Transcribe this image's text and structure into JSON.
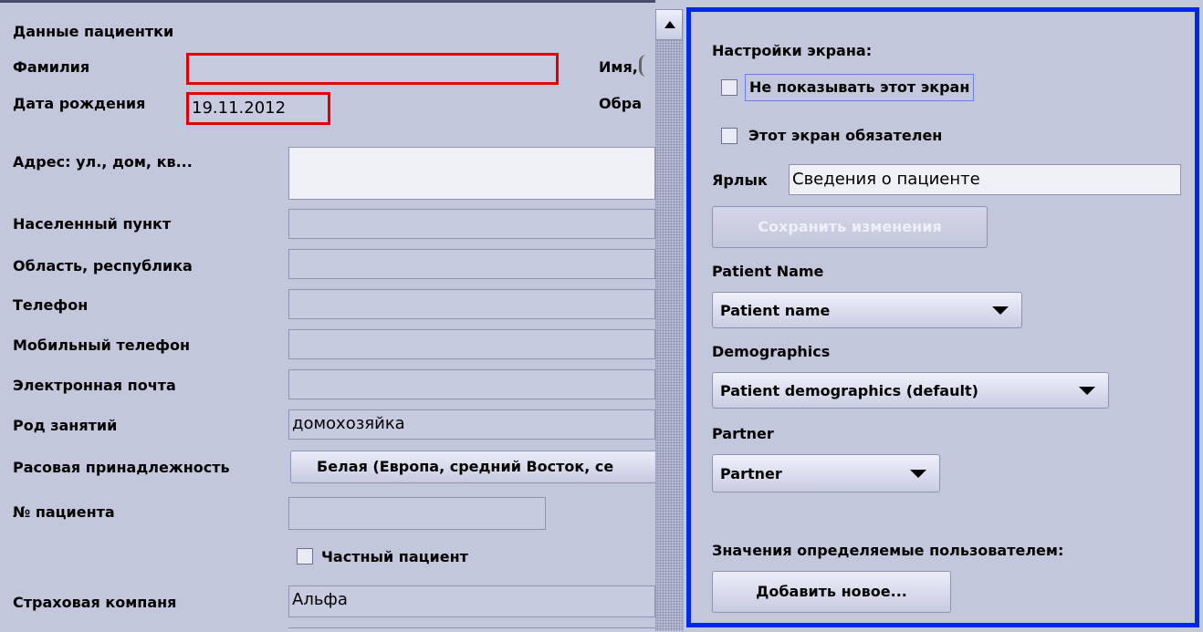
{
  "patient": {
    "section_title": "Данные пациентки",
    "surname_label": "Фамилия",
    "surname_value": "",
    "name_label": "Имя,",
    "dob_label": "Дата рождения",
    "dob_value": "19.11.2012",
    "education_label": "Обра",
    "address_label": "Адрес: ул., дом, кв...",
    "city_label": "Населенный пункт",
    "region_label": "Область, республика",
    "phone_label": "Телефон",
    "mobile_label": "Мобильный телефон",
    "email_label": "Электронная почта",
    "occupation_label": "Род занятий",
    "occupation_value": "домохозяйка",
    "race_label": "Расовая принадлежность",
    "race_value": "Белая (Европа, средний Восток, се",
    "patient_no_label": "№ пациента",
    "private_label": "Частный пациент",
    "insurance_label": "Страховая компаня",
    "insurance_value": "Альфа"
  },
  "settings": {
    "title": "Настройки экрана:",
    "hide_label": "Не показывать этот экран",
    "required_label": "Этот экран обязателен",
    "shortcut_label": "Ярлык",
    "shortcut_value": "Сведения о пациенте",
    "save_label": "Сохранить изменения",
    "patient_name_label": "Patient Name",
    "patient_name_value": "Patient name",
    "demographics_label": "Demographics",
    "demographics_value": "Patient demographics (default)",
    "partner_label": "Partner",
    "partner_value": "Partner",
    "user_values_label": "Значения определяемые пользователем:",
    "add_new_label": "Добавить новое..."
  },
  "colors": {
    "panel_border": "#0028e6",
    "highlight": "#e00000",
    "background": "#c3c7dc"
  }
}
